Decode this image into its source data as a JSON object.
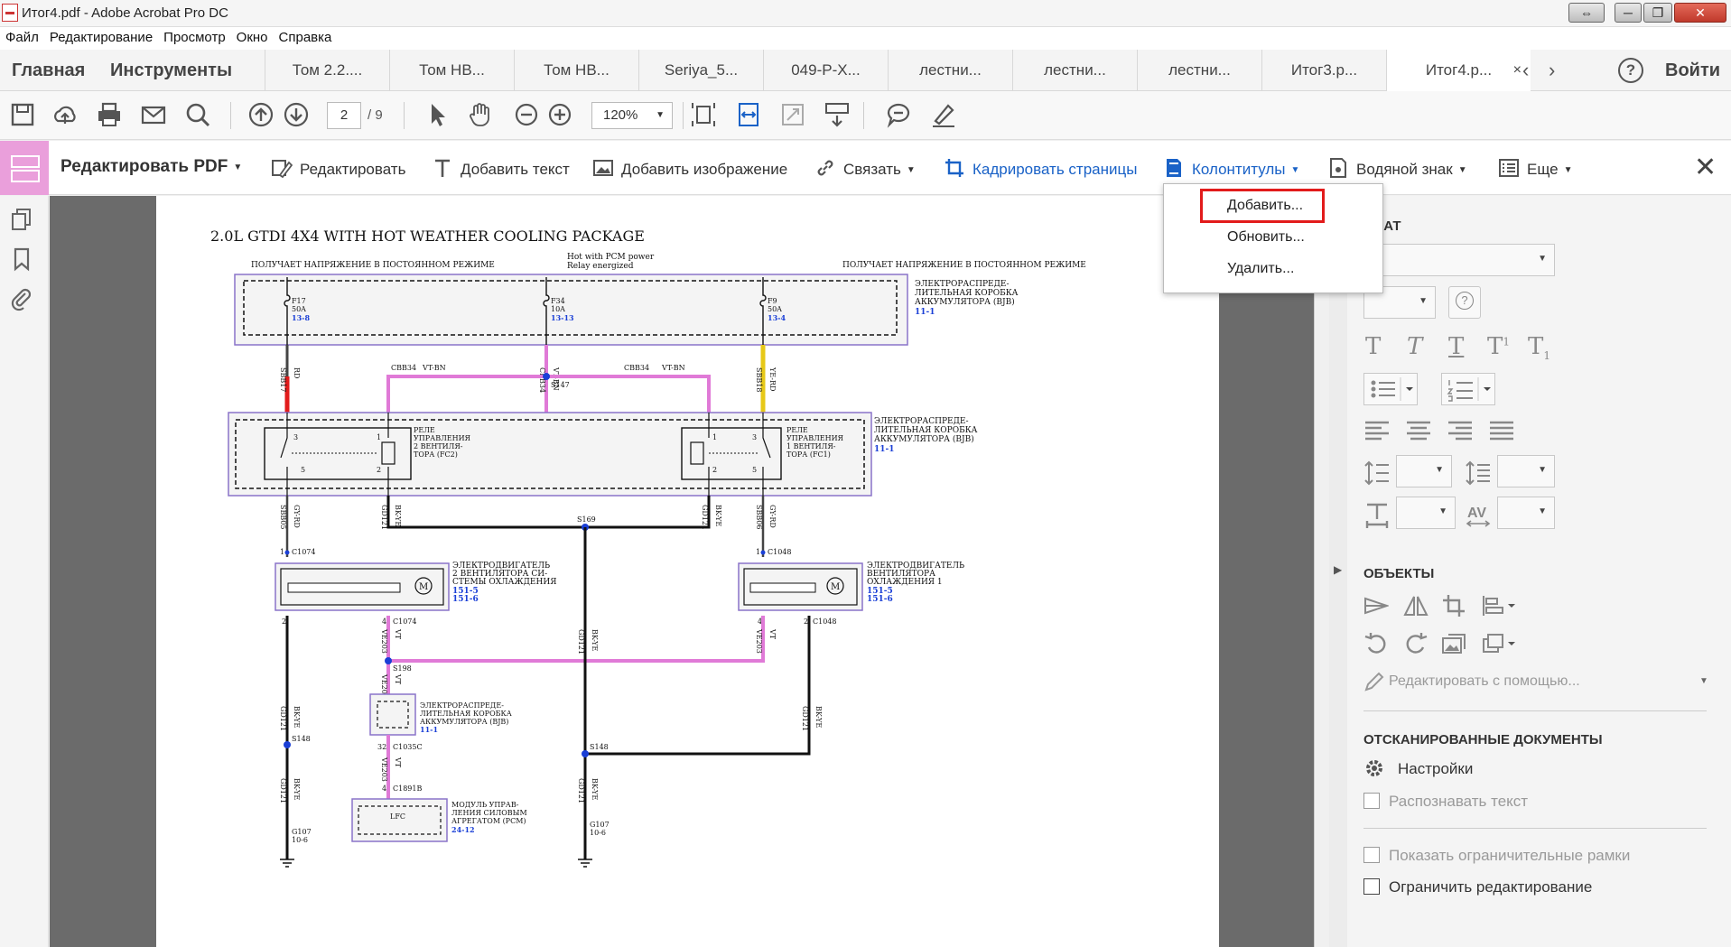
{
  "window": {
    "title": "Итог4.pdf - Adobe Acrobat Pro DC",
    "buttons": [
      "⇔",
      "─",
      "❐",
      "✕"
    ]
  },
  "menu": [
    "Файл",
    "Редактирование",
    "Просмотр",
    "Окно",
    "Справка"
  ],
  "tabs": {
    "home": "Главная",
    "tools": "Инструменты",
    "docs": [
      "Том 2.2....",
      "Том НВ...",
      "Том НВ...",
      "Seriya_5...",
      "049-Р-Х...",
      "лестни...",
      "лестни...",
      "лестни...",
      "Итог3.p..."
    ],
    "active_doc": "Итог4.p...",
    "close": "×",
    "help": "?",
    "login": "Войти"
  },
  "toolbar": {
    "page_current": "2",
    "page_total": "/ 9",
    "zoom": "120%"
  },
  "editbar": {
    "title": "Редактировать PDF",
    "edit": "Редактировать",
    "add_text": "Добавить текст",
    "add_image": "Добавить изображение",
    "link": "Связать",
    "crop": "Кадрировать страницы",
    "header_footer": "Колонтитулы",
    "watermark": "Водяной знак",
    "more": "Еще"
  },
  "dropdown": {
    "items": [
      "Добавить...",
      "Обновить...",
      "Удалить..."
    ],
    "highlight_color": "#e21b1b"
  },
  "rightpanel": {
    "format_header": "РМАТ",
    "objects_header": "ОБЪЕКТЫ",
    "edit_with": "Редактировать с помощью...",
    "scanned_header": "ОТСКАНИРОВАННЫЕ ДОКУМЕНТЫ",
    "settings": "Настройки",
    "recognize_text": "Распознавать текст",
    "show_bounding": "Показать ограничительные рамки",
    "restrict_edit": "Ограничить редактирование"
  },
  "diagram": {
    "title": "2.0L GTDI 4X4 WITH HOT WEATHER COOLING PACKAGE",
    "top_left_note": "ПОЛУЧАЕТ НАПРЯЖЕНИЕ В ПОСТОЯННОМ РЕЖИМЕ",
    "top_right_note": "ПОЛУЧАЕТ НАПРЯЖЕНИЕ В ПОСТОЯННОМ РЕЖИМЕ",
    "pcm_note_1": "Hot with PCM power",
    "pcm_note_2": "Relay energized",
    "bjb_1": "ЭЛЕКТРОРАСПРЕДЕ-",
    "bjb_2": "ЛИТЕЛЬНАЯ КОРОБКА",
    "bjb_3": "АККУМУЛЯТОРА (BJB)",
    "ref_11_1": "11-1",
    "f17_a": "F17",
    "f17_b": "50A",
    "f17_c": "13-8",
    "f34_a": "F34",
    "f34_b": "10A",
    "f34_c": "13-13",
    "f9_a": "F9",
    "f9_b": "50A",
    "f9_c": "13-4",
    "w_sbb17": "SBB17",
    "w_rd": "RD",
    "w_cbb34": "CBB34",
    "w_vtbn": "VT-BN",
    "w_sbb18": "SBB18",
    "w_yerd": "YE-RD",
    "s147": "S147",
    "relay2_1": "РЕЛЕ",
    "relay2_2": "УПРАВЛЕНИЯ",
    "relay2_3": "2 ВЕНТИЛЯ-",
    "relay2_4": "ТОРА (FC2)",
    "relay1_1": "РЕЛЕ",
    "relay1_2": "УПРАВЛЕНИЯ",
    "relay1_3": "1 ВЕНТИЛЯ-",
    "relay1_4": "ТОРА (FC1)",
    "w_sbb05": "SBB05",
    "w_gyrd": "GY-RD",
    "w_gd121": "GD121",
    "w_bkye": "BK-YE",
    "w_sbb06": "SBB06",
    "s169": "S169",
    "c1074": "C1074",
    "c1048": "C1048",
    "motor2_1": "ЭЛЕКТРОДВИГАТЕЛЬ",
    "motor2_2": "2 ВЕНТИЛЯТОРА СИ-",
    "motor2_3": "СТЕМЫ ОХЛАЖДЕНИЯ",
    "motor1_1": "ЭЛЕКТРОДВИГАТЕЛЬ",
    "motor1_2": "ВЕНТИЛЯТОРА",
    "motor1_3": "ОХЛАЖДЕНИЯ 1",
    "ref_151_5": "151-5",
    "ref_151_6": "151-6",
    "w_ve203": "VE203",
    "w_vt": "VT",
    "s198": "S198",
    "s148": "S148",
    "bjb2_1": "ЭЛЕКТРОРАСПРЕДЕ-",
    "bjb2_2": "ЛИТЕЛЬНАЯ КОРОБКА",
    "bjb2_3": "АККУМУЛЯТОРА (BJB)",
    "c1035c": "C1035C",
    "c1891b": "C1891B",
    "pcm_1": "МОДУЛЬ УПРАВ-",
    "pcm_2": "ЛЕНИЯ СИЛОВЫМ",
    "pcm_3": "АГРЕГАТОМ (PCM)",
    "ref_24_12": "24-12",
    "lfc": "LFC",
    "g107": "G107",
    "ref_10_6": "10-6",
    "pin_1": "1",
    "pin_2": "2",
    "pin_3": "3",
    "pin_4": "4",
    "pin_5": "5",
    "pin_32": "32"
  },
  "colors": {
    "wire_red": "#e21b1b",
    "wire_pink": "#e07ad7",
    "wire_yellow": "#e7c817",
    "junction_blue": "#1a3fd6",
    "accent_blue": "#1a62c7",
    "edit_pink": "#ea9fdb"
  }
}
